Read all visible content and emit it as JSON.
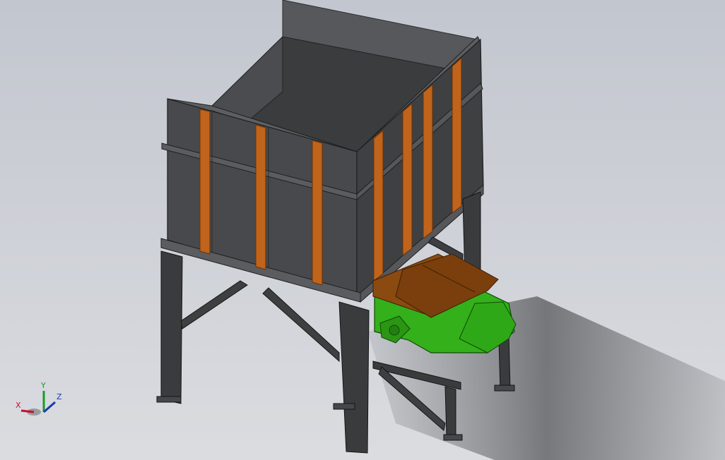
{
  "viewport": {
    "background_top": "#c2c6ce",
    "background_bottom": "#dadce0"
  },
  "model": {
    "hopper_color": "#484a4c",
    "stiffener_color": "#c0631b",
    "frame_color": "#3a3b3d",
    "feeder_color": "#33b01a",
    "liner_color": "#8a4a10"
  },
  "triad": {
    "x_label": "X",
    "y_label": "Y",
    "z_label": "Z",
    "x_color": "#c8102e",
    "y_color": "#1a9a2a",
    "z_color": "#1a3ab0"
  }
}
